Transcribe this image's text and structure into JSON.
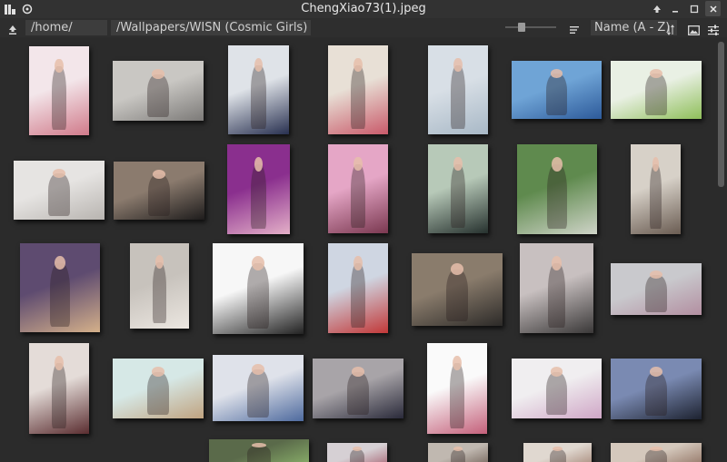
{
  "window": {
    "title": "ChengXiao73(1).jpeg"
  },
  "toolbar": {
    "path_prefix": "/home/",
    "path_suffix": "/Wallpapers/WISN (Cosmic Girls)",
    "sort_label": "Name (A - Z)",
    "zoom_level": 0.3
  },
  "thumbnails": [
    {
      "name": "thumb-1",
      "colors": [
        "#f3e6ea",
        "#d07a8a"
      ]
    },
    {
      "name": "thumb-2",
      "colors": [
        "#c9c7c3",
        "#7c7a78"
      ]
    },
    {
      "name": "thumb-3",
      "colors": [
        "#dfe3e8",
        "#283050"
      ]
    },
    {
      "name": "thumb-4",
      "colors": [
        "#e8e0d6",
        "#c95a6a"
      ]
    },
    {
      "name": "thumb-5",
      "colors": [
        "#d8dfe6",
        "#a8b8c6"
      ]
    },
    {
      "name": "thumb-6",
      "colors": [
        "#6fa4d6",
        "#2d5a9a"
      ]
    },
    {
      "name": "thumb-7",
      "colors": [
        "#e9f0e4",
        "#8fbf5a"
      ]
    },
    {
      "name": "thumb-8",
      "colors": [
        "#e6e4e2",
        "#b8b4b0"
      ]
    },
    {
      "name": "thumb-9",
      "colors": [
        "#8b7b6e",
        "#1e1c1c"
      ]
    },
    {
      "name": "thumb-10",
      "colors": [
        "#8a2f8e",
        "#e4b0c8"
      ]
    },
    {
      "name": "thumb-11",
      "colors": [
        "#e5a6c6",
        "#7a3850"
      ]
    },
    {
      "name": "thumb-12",
      "colors": [
        "#b7c9b8",
        "#26312e"
      ]
    },
    {
      "name": "thumb-13",
      "colors": [
        "#5f8a4e",
        "#cfd4c8"
      ]
    },
    {
      "name": "thumb-14",
      "colors": [
        "#d7d1c8",
        "#6a5c52"
      ]
    },
    {
      "name": "thumb-15",
      "colors": [
        "#5e4b70",
        "#d4b08a"
      ]
    },
    {
      "name": "thumb-16",
      "colors": [
        "#c7c2bc",
        "#ece7e1"
      ]
    },
    {
      "name": "thumb-17",
      "colors": [
        "#f7f7f7",
        "#222222"
      ]
    },
    {
      "name": "thumb-18",
      "colors": [
        "#cfd6e2",
        "#c23838"
      ]
    },
    {
      "name": "thumb-19",
      "colors": [
        "#8a7c6c",
        "#2c2a28"
      ]
    },
    {
      "name": "thumb-20",
      "colors": [
        "#c8c0c0",
        "#3a3838"
      ]
    },
    {
      "name": "thumb-21",
      "colors": [
        "#c9c9cd",
        "#b28ea0"
      ]
    },
    {
      "name": "thumb-22",
      "colors": [
        "#e4dcd8",
        "#5a2d30"
      ]
    },
    {
      "name": "thumb-23",
      "colors": [
        "#d6e8e6",
        "#c0a380"
      ]
    },
    {
      "name": "thumb-24",
      "colors": [
        "#dfe2ea",
        "#4e6a9e"
      ]
    },
    {
      "name": "thumb-25",
      "colors": [
        "#a8a4a8",
        "#2a2a3a"
      ]
    },
    {
      "name": "thumb-26",
      "colors": [
        "#fafafa",
        "#c4607a"
      ]
    },
    {
      "name": "thumb-27",
      "colors": [
        "#f0eef0",
        "#cfa6c6"
      ]
    },
    {
      "name": "thumb-28",
      "colors": [
        "#7a8ab2",
        "#1d2230"
      ]
    },
    {
      "name": "thumb-29",
      "colors": [
        "#5a6a4a",
        "#8ab06a"
      ]
    },
    {
      "name": "thumb-30",
      "colors": [
        "#d6d0d4",
        "#a25a6a"
      ]
    },
    {
      "name": "thumb-31",
      "colors": [
        "#c0b8b0",
        "#6a5a50"
      ]
    },
    {
      "name": "thumb-32",
      "colors": [
        "#e0d8d0",
        "#a08070"
      ]
    },
    {
      "name": "thumb-33",
      "colors": [
        "#d4c8bc",
        "#8a6a5a"
      ]
    }
  ]
}
